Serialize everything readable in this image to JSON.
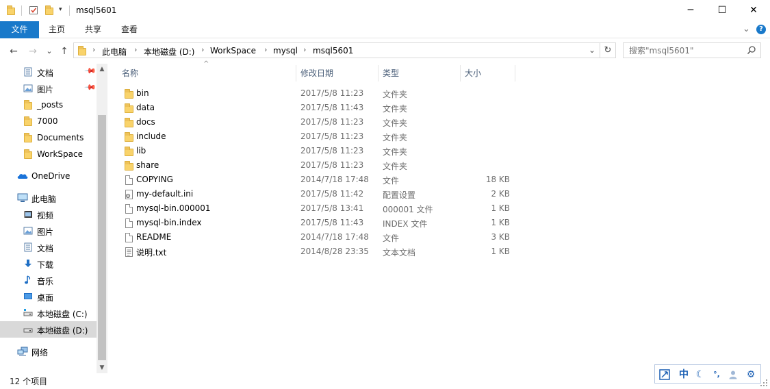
{
  "window": {
    "title": "msql5601",
    "minimize_glyph": "─",
    "maximize_glyph": "☐",
    "close_glyph": "✕"
  },
  "ribbon": {
    "tabs": [
      {
        "label": "文件",
        "active": true
      },
      {
        "label": "主页",
        "active": false
      },
      {
        "label": "共享",
        "active": false
      },
      {
        "label": "查看",
        "active": false
      }
    ],
    "expand_glyph": "⌄",
    "help_glyph": "?"
  },
  "address": {
    "breadcrumbs": [
      "此电脑",
      "本地磁盘 (D:)",
      "WorkSpace",
      "mysql",
      "msql5601"
    ],
    "separator": "›",
    "dropdown_glyph": "⌄",
    "refresh_glyph": "↻"
  },
  "nav_glyphs": {
    "back": "←",
    "forward": "→",
    "recent": "⌄",
    "up": "↑"
  },
  "search": {
    "placeholder": "搜索\"msql5601\""
  },
  "nav_pane": {
    "quick_access": [
      {
        "label": "文档",
        "icon": "document-icon",
        "pinned": true
      },
      {
        "label": "图片",
        "icon": "picture-icon",
        "pinned": true
      },
      {
        "label": "_posts",
        "icon": "folder-icon",
        "pinned": false
      },
      {
        "label": "7000",
        "icon": "folder-icon",
        "pinned": false
      },
      {
        "label": "Documents",
        "icon": "folder-icon",
        "pinned": false
      },
      {
        "label": "WorkSpace",
        "icon": "folder-icon",
        "pinned": false
      }
    ],
    "onedrive": {
      "label": "OneDrive",
      "icon": "cloud-icon"
    },
    "this_pc": {
      "label": "此电脑",
      "icon": "computer-icon"
    },
    "pc_items": [
      {
        "label": "视频",
        "icon": "video-icon"
      },
      {
        "label": "图片",
        "icon": "picture-icon"
      },
      {
        "label": "文档",
        "icon": "document-icon"
      },
      {
        "label": "下载",
        "icon": "download-icon"
      },
      {
        "label": "音乐",
        "icon": "music-icon"
      },
      {
        "label": "桌面",
        "icon": "desktop-icon"
      },
      {
        "label": "本地磁盘 (C:)",
        "icon": "drive-icon"
      },
      {
        "label": "本地磁盘 (D:)",
        "icon": "drive-icon"
      }
    ],
    "network": {
      "label": "网络",
      "icon": "network-icon"
    },
    "scroll_up_glyph": "▲",
    "scroll_down_glyph": "▼"
  },
  "columns": {
    "name": "名称",
    "date": "修改日期",
    "type": "类型",
    "size": "大小",
    "sort_glyph": "^"
  },
  "files": [
    {
      "name": "bin",
      "date": "2017/5/8 11:23",
      "type": "文件夹",
      "size": "",
      "kind": "folder"
    },
    {
      "name": "data",
      "date": "2017/5/8 11:43",
      "type": "文件夹",
      "size": "",
      "kind": "folder"
    },
    {
      "name": "docs",
      "date": "2017/5/8 11:23",
      "type": "文件夹",
      "size": "",
      "kind": "folder"
    },
    {
      "name": "include",
      "date": "2017/5/8 11:23",
      "type": "文件夹",
      "size": "",
      "kind": "folder"
    },
    {
      "name": "lib",
      "date": "2017/5/8 11:23",
      "type": "文件夹",
      "size": "",
      "kind": "folder"
    },
    {
      "name": "share",
      "date": "2017/5/8 11:23",
      "type": "文件夹",
      "size": "",
      "kind": "folder"
    },
    {
      "name": "COPYING",
      "date": "2014/7/18 17:48",
      "type": "文件",
      "size": "18 KB",
      "kind": "file"
    },
    {
      "name": "my-default.ini",
      "date": "2017/5/8 11:42",
      "type": "配置设置",
      "size": "2 KB",
      "kind": "config"
    },
    {
      "name": "mysql-bin.000001",
      "date": "2017/5/8 13:41",
      "type": "000001 文件",
      "size": "1 KB",
      "kind": "file"
    },
    {
      "name": "mysql-bin.index",
      "date": "2017/5/8 11:43",
      "type": "INDEX 文件",
      "size": "1 KB",
      "kind": "file"
    },
    {
      "name": "README",
      "date": "2014/7/18 17:48",
      "type": "文件",
      "size": "3 KB",
      "kind": "file"
    },
    {
      "name": "说明.txt",
      "date": "2014/8/28 23:35",
      "type": "文本文档",
      "size": "1 KB",
      "kind": "text"
    }
  ],
  "status": {
    "item_count": "12 个项目"
  },
  "ime": {
    "lang": "中",
    "punct_glyph": "°,"
  },
  "colors": {
    "accent": "#1979ca",
    "selected_bg": "#cce8ff",
    "folder": "#f9d36b"
  }
}
